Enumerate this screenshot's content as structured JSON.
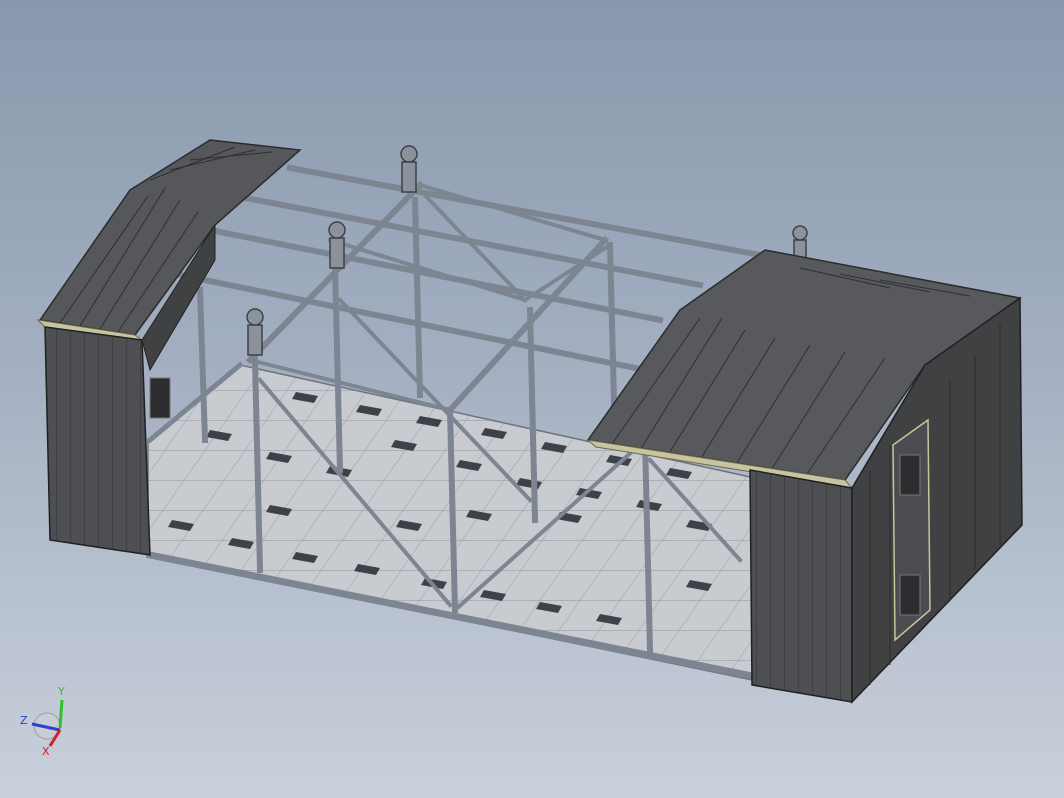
{
  "viewport": {
    "background_top": "#8998ad",
    "background_bottom": "#c9d0db",
    "model": "steel-frame-shelter"
  },
  "triad": {
    "y_label": "Y",
    "z_label": "Z",
    "x_label": "X",
    "y_color": "#2fbf2f",
    "z_color": "#2b3fd1",
    "x_color": "#d11e1e"
  },
  "colors": {
    "panel_dark": "#4b4d50",
    "panel_mid": "#5c5e61",
    "frame": "#7f8794",
    "floor": "#c7cacf",
    "trim": "#c9c39a"
  }
}
